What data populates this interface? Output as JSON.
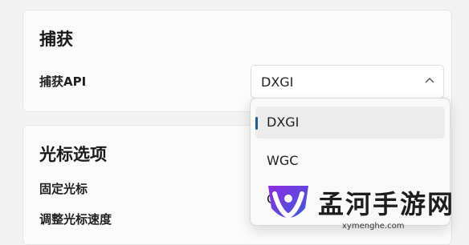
{
  "capture": {
    "title": "捕获",
    "api_label": "捕获API",
    "api_value": "DXGI"
  },
  "cursor": {
    "title": "光标选项",
    "fixed_label": "固定光标",
    "speed_label": "调整光标速度"
  },
  "dropdown": {
    "options": [
      "DXGI",
      "WGC",
      "G"
    ]
  },
  "watermark": {
    "name": "孟河手游网",
    "url": "xymenghe.com"
  },
  "icons": {
    "select": "chevron-up-icon",
    "watermark": "logo-icon"
  },
  "colors": {
    "accent": "#1f5e8f",
    "logo_purple": "#7b2dc9",
    "logo_blue": "#3b5bdb"
  }
}
